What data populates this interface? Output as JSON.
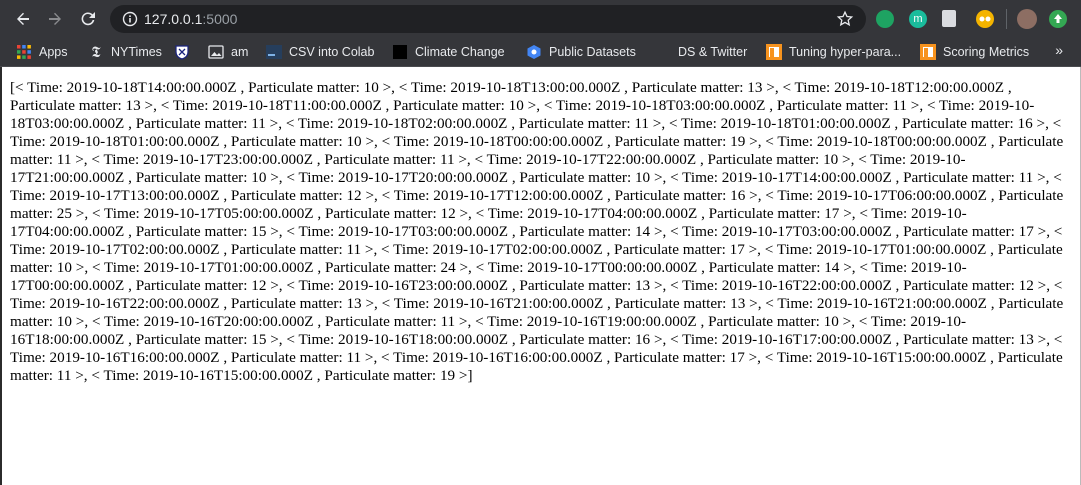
{
  "browser": {
    "url_host": "127.0.0.1",
    "url_port": ":5000"
  },
  "bookmarks": [
    {
      "label": "Apps",
      "icon": "apps-grid-icon"
    },
    {
      "label": "NYTimes",
      "icon": "nytimes-icon"
    },
    {
      "label": "",
      "icon": "shield-crest-icon"
    },
    {
      "label": "am",
      "icon": "image-icon"
    },
    {
      "label": "CSV into Colab",
      "icon": "colab-icon"
    },
    {
      "label": "Climate Change",
      "icon": "black-square-icon"
    },
    {
      "label": "Public Datasets",
      "icon": "datasets-icon"
    },
    {
      "label": "DS & Twitter",
      "icon": ""
    },
    {
      "label": "Tuning hyper-para...",
      "icon": "orange-bookmark-icon"
    },
    {
      "label": "Scoring Metrics",
      "icon": "orange-bookmark-icon"
    }
  ],
  "bookmarks_more": "»",
  "page": {
    "output_text": "[< Time: 2019-10-18T14:00:00.000Z , Particulate matter: 10 >, < Time: 2019-10-18T13:00:00.000Z , Particulate matter: 13 >, < Time: 2019-10-18T12:00:00.000Z , Particulate matter: 13 >, < Time: 2019-10-18T11:00:00.000Z , Particulate matter: 10 >, < Time: 2019-10-18T03:00:00.000Z , Particulate matter: 11 >, < Time: 2019-10-18T03:00:00.000Z , Particulate matter: 11 >, < Time: 2019-10-18T02:00:00.000Z , Particulate matter: 11 >, < Time: 2019-10-18T01:00:00.000Z , Particulate matter: 16 >, < Time: 2019-10-18T01:00:00.000Z , Particulate matter: 10 >, < Time: 2019-10-18T00:00:00.000Z , Particulate matter: 19 >, < Time: 2019-10-18T00:00:00.000Z , Particulate matter: 11 >, < Time: 2019-10-17T23:00:00.000Z , Particulate matter: 11 >, < Time: 2019-10-17T22:00:00.000Z , Particulate matter: 10 >, < Time: 2019-10-17T21:00:00.000Z , Particulate matter: 10 >, < Time: 2019-10-17T20:00:00.000Z , Particulate matter: 10 >, < Time: 2019-10-17T14:00:00.000Z , Particulate matter: 11 >, < Time: 2019-10-17T13:00:00.000Z , Particulate matter: 12 >, < Time: 2019-10-17T12:00:00.000Z , Particulate matter: 16 >, < Time: 2019-10-17T06:00:00.000Z , Particulate matter: 25 >, < Time: 2019-10-17T05:00:00.000Z , Particulate matter: 12 >, < Time: 2019-10-17T04:00:00.000Z , Particulate matter: 17 >, < Time: 2019-10-17T04:00:00.000Z , Particulate matter: 15 >, < Time: 2019-10-17T03:00:00.000Z , Particulate matter: 14 >, < Time: 2019-10-17T03:00:00.000Z , Particulate matter: 17 >, < Time: 2019-10-17T02:00:00.000Z , Particulate matter: 11 >, < Time: 2019-10-17T02:00:00.000Z , Particulate matter: 17 >, < Time: 2019-10-17T01:00:00.000Z , Particulate matter: 10 >, < Time: 2019-10-17T01:00:00.000Z , Particulate matter: 24 >, < Time: 2019-10-17T00:00:00.000Z , Particulate matter: 14 >, < Time: 2019-10-17T00:00:00.000Z , Particulate matter: 12 >, < Time: 2019-10-16T23:00:00.000Z , Particulate matter: 13 >, < Time: 2019-10-16T22:00:00.000Z , Particulate matter: 12 >, < Time: 2019-10-16T22:00:00.000Z , Particulate matter: 13 >, < Time: 2019-10-16T21:00:00.000Z , Particulate matter: 13 >, < Time: 2019-10-16T21:00:00.000Z , Particulate matter: 10 >, < Time: 2019-10-16T20:00:00.000Z , Particulate matter: 11 >, < Time: 2019-10-16T19:00:00.000Z , Particulate matter: 10 >, < Time: 2019-10-16T18:00:00.000Z , Particulate matter: 15 >, < Time: 2019-10-16T18:00:00.000Z , Particulate matter: 16 >, < Time: 2019-10-16T17:00:00.000Z , Particulate matter: 13 >, < Time: 2019-10-16T16:00:00.000Z , Particulate matter: 11 >, < Time: 2019-10-16T16:00:00.000Z , Particulate matter: 17 >, < Time: 2019-10-16T15:00:00.000Z , Particulate matter: 11 >, < Time: 2019-10-16T15:00:00.000Z , Particulate matter: 19 >]"
  },
  "colors": {
    "chrome_bg": "#35363a",
    "omnibox_bg": "#202124",
    "text_light": "#e8eaed",
    "port_grey": "#9aa0a6"
  }
}
